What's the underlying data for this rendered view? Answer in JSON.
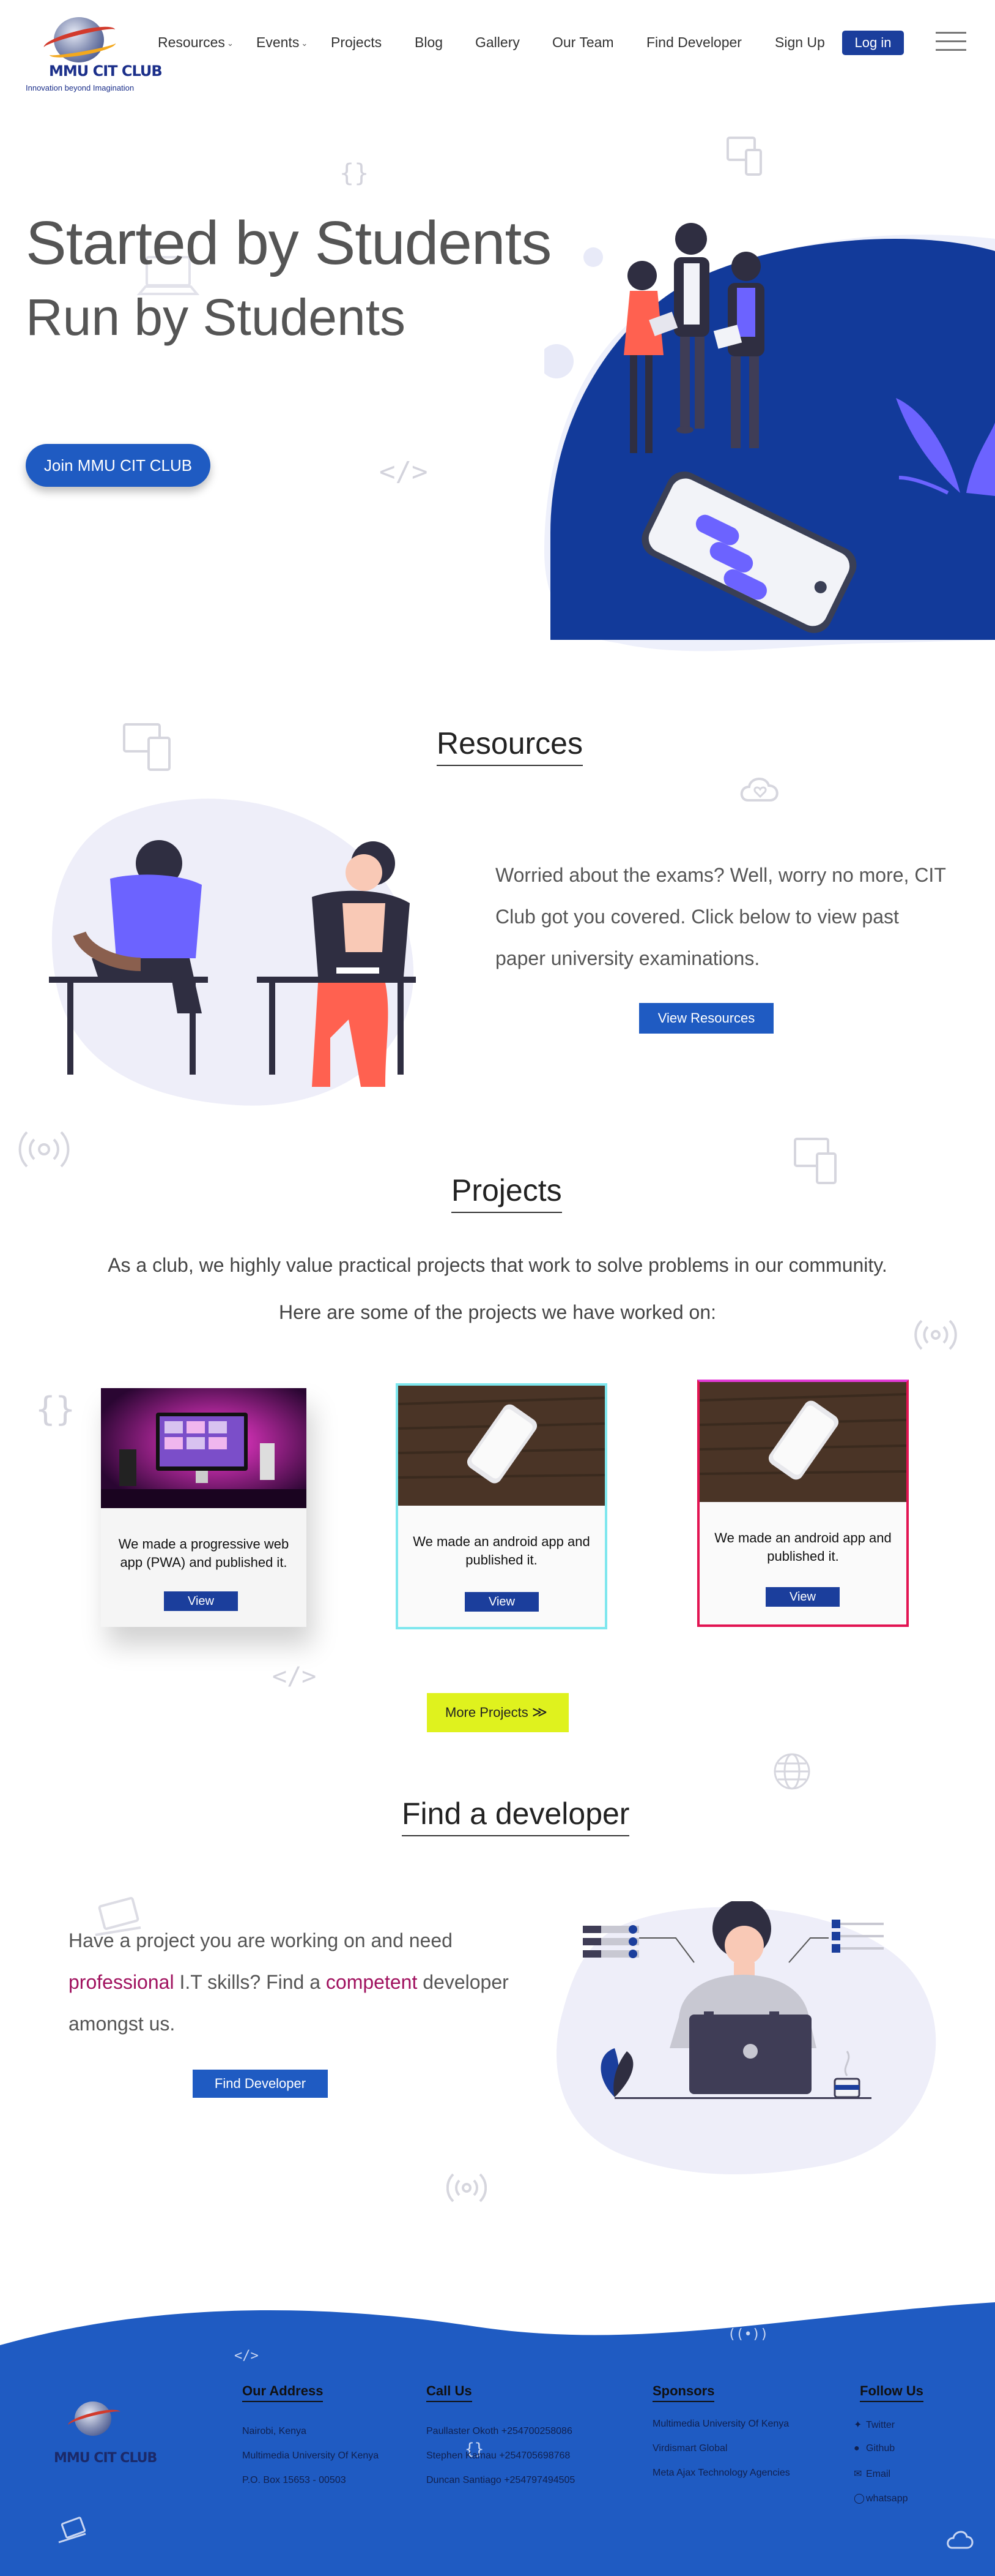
{
  "nav": {
    "logo_name": "MMU CIT CLUB",
    "logo_tagline": "Innovation beyond Imagination",
    "items": [
      {
        "label": "Resources",
        "dropdown": true
      },
      {
        "label": "Events",
        "dropdown": true
      },
      {
        "label": "Projects"
      },
      {
        "label": "Blog"
      },
      {
        "label": "Gallery"
      },
      {
        "label": "Our Team"
      },
      {
        "label": "Find Developer"
      },
      {
        "label": "Sign Up"
      }
    ],
    "login_label": "Log in",
    "menu_icon": "hamburger-icon"
  },
  "hero": {
    "title_line1": "Started by Students",
    "title_line2": "Run by Students",
    "cta_label": "Join MMU CIT CLUB"
  },
  "resources": {
    "title": "Resources",
    "text": "Worried about the exams? Well, worry no more, CIT Club got you covered. Click below to view past paper university examinations.",
    "button_label": "View Resources"
  },
  "projects": {
    "title": "Projects",
    "intro1": "As a club, we highly value practical projects that work to solve problems in our community.",
    "intro2": "Here are some of the projects we have worked on:",
    "cards": [
      {
        "text": "We made a progressive web app (PWA) and published it.",
        "button": "View"
      },
      {
        "text": "We made an android app and published it.",
        "button": "View"
      },
      {
        "text": "We made an android app and published it.",
        "button": "View"
      }
    ],
    "more_label": "More Projects"
  },
  "developer": {
    "title": "Find a developer",
    "text_part1": "Have a project you are working on and need ",
    "highlight1": "professional",
    "text_part2": " I.T skills? Find a ",
    "highlight2": "competent",
    "text_part3": " developer amongst us.",
    "button_label": "Find Developer"
  },
  "footer": {
    "logo_name": "MMU CIT CLUB",
    "address": {
      "title": "Our Address",
      "lines": [
        "Nairobi, Kenya",
        "Multimedia University Of Kenya",
        "P.O. Box 15653 - 00503"
      ]
    },
    "call": {
      "title": "Call Us",
      "lines": [
        "Paullaster Okoth  +254700258086",
        "Stephen Kamau  +254705698768",
        "Duncan Santiago  +254797494505"
      ]
    },
    "sponsors": {
      "title": "Sponsors",
      "lines": [
        "Multimedia University Of Kenya",
        "Virdismart Global",
        "Meta Ajax Technology Agencies"
      ]
    },
    "follow": {
      "title": "Follow Us",
      "items": [
        {
          "label": "Twitter",
          "icon": "twitter-icon"
        },
        {
          "label": "Github",
          "icon": "github-icon"
        },
        {
          "label": "Email",
          "icon": "email-icon"
        },
        {
          "label": "whatsapp",
          "icon": "whatsapp-icon"
        }
      ]
    }
  },
  "colors": {
    "primary_blue": "#1f5bc2",
    "dark_blue": "#1b3e9c",
    "hero_blob": "#123a9a",
    "more_button": "#dff21e",
    "highlight": "#a0125f"
  }
}
